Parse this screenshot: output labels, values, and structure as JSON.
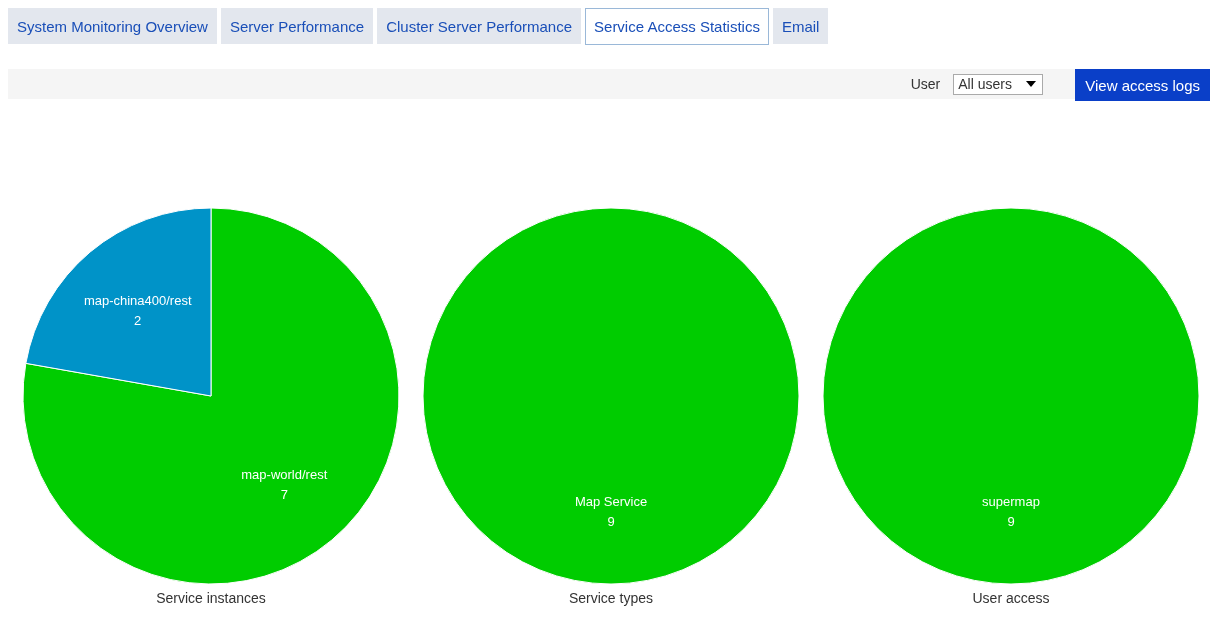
{
  "tabs": [
    {
      "label": "System Monitoring Overview",
      "selected": false
    },
    {
      "label": "Server Performance",
      "selected": false
    },
    {
      "label": "Cluster Server Performance",
      "selected": false
    },
    {
      "label": "Service Access Statistics",
      "selected": true
    },
    {
      "label": "Email",
      "selected": false
    }
  ],
  "toolbar": {
    "user_label": "User",
    "user_select": {
      "value": "All users"
    },
    "button": "View access logs"
  },
  "charts": [
    {
      "chart_data": {
        "type": "pie",
        "title": "Service instances",
        "data_labels": true,
        "categories": [
          "map-world/rest",
          "map-china400/rest"
        ],
        "values": [
          7,
          2
        ],
        "colors": [
          "#00cc00",
          "#0093c8"
        ]
      }
    },
    {
      "chart_data": {
        "type": "pie",
        "title": "Service types",
        "data_labels": true,
        "categories": [
          "Map Service"
        ],
        "values": [
          9
        ],
        "colors": [
          "#00cc00"
        ]
      }
    },
    {
      "chart_data": {
        "type": "pie",
        "title": "User access",
        "data_labels": true,
        "categories": [
          "supermap"
        ],
        "values": [
          9
        ],
        "colors": [
          "#00cc00"
        ]
      }
    }
  ]
}
